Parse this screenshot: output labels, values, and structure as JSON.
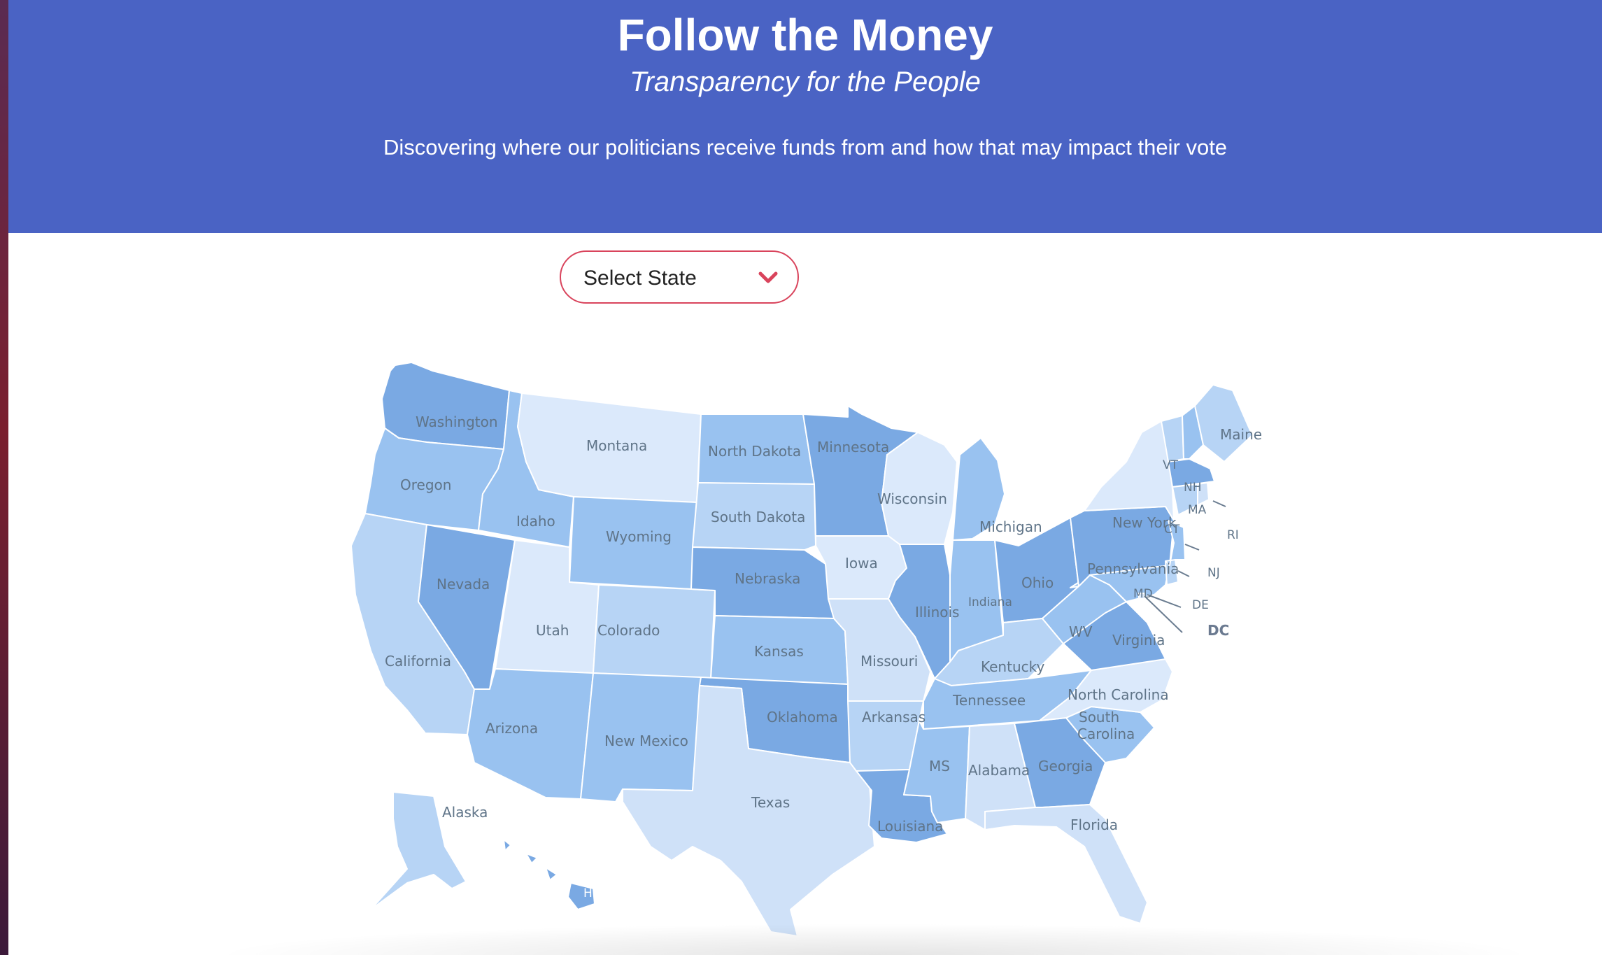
{
  "header": {
    "title": "Follow the Money",
    "subtitle": "Transparency for the People",
    "description": "Discovering where our politicians receive funds from and how that may impact their vote"
  },
  "state_select": {
    "selected": "Select State",
    "icon": "chevron-down-icon"
  },
  "colors": {
    "header_bg": "#4a63c4",
    "select_border": "#d9445c",
    "map_scale": [
      "#dbe9fb",
      "#cfe1f8",
      "#b7d4f5",
      "#99c2f0",
      "#7aa9e3"
    ]
  },
  "map": {
    "states": [
      {
        "name": "Washington",
        "level": 4
      },
      {
        "name": "Oregon",
        "level": 3
      },
      {
        "name": "California",
        "level": 2
      },
      {
        "name": "Nevada",
        "level": 4
      },
      {
        "name": "Idaho",
        "level": 3
      },
      {
        "name": "Montana",
        "level": 0
      },
      {
        "name": "Wyoming",
        "level": 3
      },
      {
        "name": "Utah",
        "level": 0
      },
      {
        "name": "Colorado",
        "level": 2
      },
      {
        "name": "Arizona",
        "level": 3
      },
      {
        "name": "New Mexico",
        "level": 3
      },
      {
        "name": "North Dakota",
        "level": 3
      },
      {
        "name": "South Dakota",
        "level": 2
      },
      {
        "name": "Nebraska",
        "level": 4
      },
      {
        "name": "Kansas",
        "level": 3
      },
      {
        "name": "Oklahoma",
        "level": 4
      },
      {
        "name": "Texas",
        "level": 1
      },
      {
        "name": "Minnesota",
        "level": 4
      },
      {
        "name": "Iowa",
        "level": 0
      },
      {
        "name": "Missouri",
        "level": 1
      },
      {
        "name": "Arkansas",
        "level": 2
      },
      {
        "name": "Louisiana",
        "level": 4
      },
      {
        "name": "Wisconsin",
        "level": 0
      },
      {
        "name": "Illinois",
        "level": 4
      },
      {
        "name": "Michigan",
        "level": 3
      },
      {
        "name": "Indiana",
        "level": 3
      },
      {
        "name": "Ohio",
        "level": 4
      },
      {
        "name": "Kentucky",
        "level": 2
      },
      {
        "name": "Tennessee",
        "level": 3
      },
      {
        "name": "MS",
        "level": 3
      },
      {
        "name": "Alabama",
        "level": 1
      },
      {
        "name": "Georgia",
        "level": 4
      },
      {
        "name": "Florida",
        "level": 1
      },
      {
        "name": "South Carolina",
        "level": 3
      },
      {
        "name": "North Carolina",
        "level": 0
      },
      {
        "name": "Virginia",
        "level": 4
      },
      {
        "name": "WV",
        "level": 3
      },
      {
        "name": "Pennsylvania",
        "level": 4
      },
      {
        "name": "New York",
        "level": 0
      },
      {
        "name": "Maine",
        "level": 2
      },
      {
        "name": "VT",
        "level": 2
      },
      {
        "name": "NH",
        "level": 3
      },
      {
        "name": "MA",
        "level": 4
      },
      {
        "name": "CT",
        "level": 2
      },
      {
        "name": "RI",
        "level": 1
      },
      {
        "name": "NJ",
        "level": 3
      },
      {
        "name": "DE",
        "level": 2
      },
      {
        "name": "MD",
        "level": 3
      },
      {
        "name": "DC",
        "level": 0
      },
      {
        "name": "Alaska",
        "level": 2
      },
      {
        "name": "HI",
        "level": 4
      }
    ]
  }
}
